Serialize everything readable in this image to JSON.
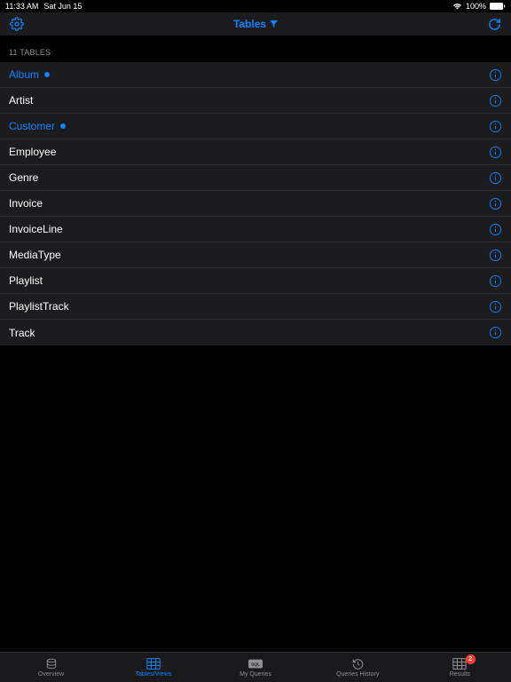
{
  "status": {
    "time": "11:33 AM",
    "date": "Sat Jun 15",
    "battery": "100%"
  },
  "nav": {
    "title": "Tables"
  },
  "section": {
    "header": "11 TABLES"
  },
  "tables": [
    {
      "name": "Album",
      "highlight": true,
      "dot": true
    },
    {
      "name": "Artist",
      "highlight": false,
      "dot": false
    },
    {
      "name": "Customer",
      "highlight": true,
      "dot": true
    },
    {
      "name": "Employee",
      "highlight": false,
      "dot": false
    },
    {
      "name": "Genre",
      "highlight": false,
      "dot": false
    },
    {
      "name": "Invoice",
      "highlight": false,
      "dot": false
    },
    {
      "name": "InvoiceLine",
      "highlight": false,
      "dot": false
    },
    {
      "name": "MediaType",
      "highlight": false,
      "dot": false
    },
    {
      "name": "Playlist",
      "highlight": false,
      "dot": false
    },
    {
      "name": "PlaylistTrack",
      "highlight": false,
      "dot": false
    },
    {
      "name": "Track",
      "highlight": false,
      "dot": false
    }
  ],
  "tabs": [
    {
      "label": "Overview",
      "icon": "database",
      "active": false,
      "badge": null
    },
    {
      "label": "Tables/Views",
      "icon": "grid",
      "active": true,
      "badge": null
    },
    {
      "label": "My Queries",
      "icon": "sql",
      "active": false,
      "badge": null
    },
    {
      "label": "Queries History",
      "icon": "history",
      "active": false,
      "badge": null
    },
    {
      "label": "Results",
      "icon": "grid",
      "active": false,
      "badge": "2"
    }
  ]
}
